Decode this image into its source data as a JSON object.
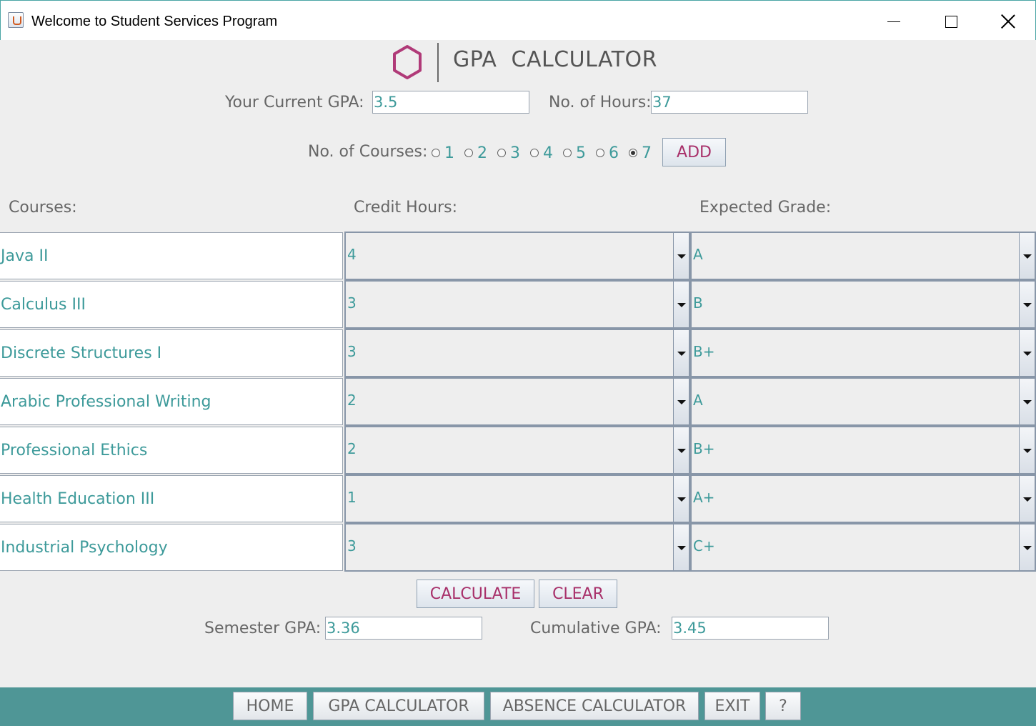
{
  "window": {
    "title": "Welcome to Student Services Program"
  },
  "header": {
    "title": "GPA  CALCULATOR"
  },
  "current": {
    "gpa_label": "Your Current GPA:",
    "gpa_value": "3.5",
    "hours_label": "No. of Hours:",
    "hours_value": "37"
  },
  "courses_count": {
    "label": "No. of Courses:",
    "options": [
      "1",
      "2",
      "3",
      "4",
      "5",
      "6",
      "7"
    ],
    "selected": "7",
    "add_label": "ADD"
  },
  "columns": {
    "courses": "Courses:",
    "credit_hours": "Credit Hours:",
    "expected_grade": "Expected Grade:"
  },
  "rows": [
    {
      "course": "Java II",
      "hours": "4",
      "grade": "A"
    },
    {
      "course": "Calculus III",
      "hours": "3",
      "grade": "B"
    },
    {
      "course": "Discrete Structures I",
      "hours": "3",
      "grade": "B+"
    },
    {
      "course": "Arabic Professional Writing",
      "hours": "2",
      "grade": "A"
    },
    {
      "course": "Professional Ethics",
      "hours": "2",
      "grade": "B+"
    },
    {
      "course": "Health Education III",
      "hours": "1",
      "grade": "A+"
    },
    {
      "course": "Industrial Psychology",
      "hours": "3",
      "grade": "C+"
    }
  ],
  "actions": {
    "calculate": "CALCULATE",
    "clear": "CLEAR"
  },
  "results": {
    "semester_label": "Semester GPA:",
    "semester_value": "3.36",
    "cumulative_label": "Cumulative GPA:",
    "cumulative_value": "3.45"
  },
  "nav": {
    "home": "HOME",
    "gpa": "GPA CALCULATOR",
    "absence": "ABSENCE CALCULATOR",
    "exit": "EXIT",
    "help": "?"
  },
  "colors": {
    "accent": "#4f9696",
    "text_teal": "#3d9a9a",
    "button_text": "#a8306a",
    "logo": "#b03a78"
  }
}
